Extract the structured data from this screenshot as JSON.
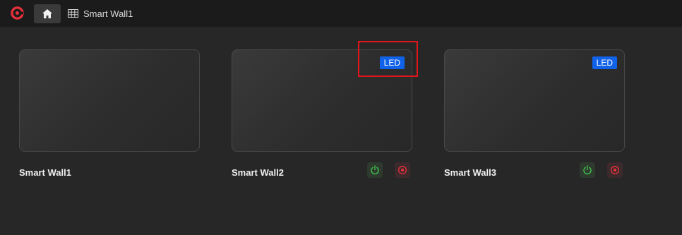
{
  "header": {
    "tab_label": "Smart Wall1"
  },
  "walls": [
    {
      "name": "Smart Wall1",
      "badge": ""
    },
    {
      "name": "Smart Wall2",
      "badge": "LED"
    },
    {
      "name": "Smart Wall3",
      "badge": "LED"
    }
  ],
  "colors": {
    "led_badge": "#1062e8",
    "power_green": "#3fbf4f",
    "record_red": "#e8303a",
    "logo_red": "#e8303a"
  }
}
